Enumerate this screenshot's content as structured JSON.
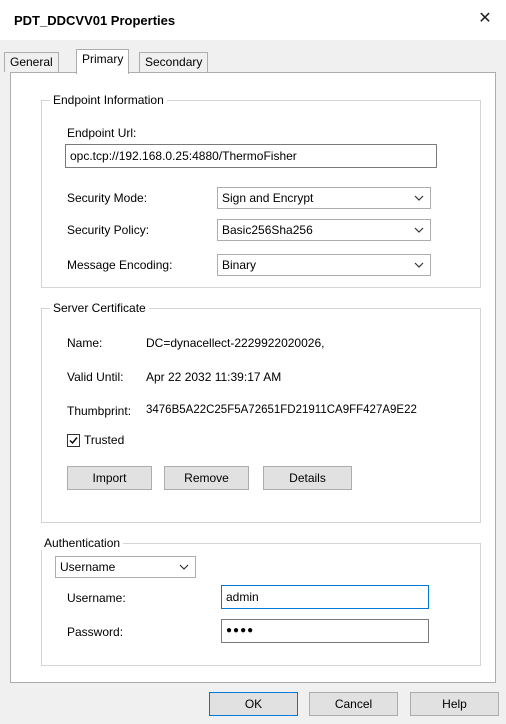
{
  "window": {
    "title": "PDT_DDCVV01 Properties",
    "close_glyph": "✕"
  },
  "tabs": [
    {
      "label": "General"
    },
    {
      "label": "Primary"
    },
    {
      "label": "Secondary"
    }
  ],
  "endpoint": {
    "group_title": "Endpoint Information",
    "url_label": "Endpoint Url:",
    "url_value": "opc.tcp://192.168.0.25:4880/ThermoFisher",
    "security_mode_label": "Security Mode:",
    "security_mode_value": "Sign and Encrypt",
    "security_policy_label": "Security Policy:",
    "security_policy_value": "Basic256Sha256",
    "encoding_label": "Message Encoding:",
    "encoding_value": "Binary"
  },
  "certificate": {
    "group_title": "Server Certificate",
    "name_label": "Name:",
    "name_value": "DC=dynacellect-2229922020026,",
    "valid_label": "Valid Until:",
    "valid_value": "Apr 22 2032 11:39:17 AM",
    "thumb_label": "Thumbprint:",
    "thumb_value": "3476B5A22C25F5A72651FD21911CA9FF427A9E22",
    "trusted_label": "Trusted",
    "trusted_checked": true,
    "import_label": "Import",
    "remove_label": "Remove",
    "details_label": "Details"
  },
  "auth": {
    "group_title": "Authentication",
    "type_value": "Username",
    "username_label": "Username:",
    "username_value": "admin",
    "password_label": "Password:",
    "password_value": "●●●●"
  },
  "footer": {
    "ok_label": "OK",
    "cancel_label": "Cancel",
    "help_label": "Help"
  },
  "colors": {
    "focus_border": "#0078d7",
    "button_bg": "#e1e1e1",
    "dialog_bg": "#f0f0f0"
  }
}
